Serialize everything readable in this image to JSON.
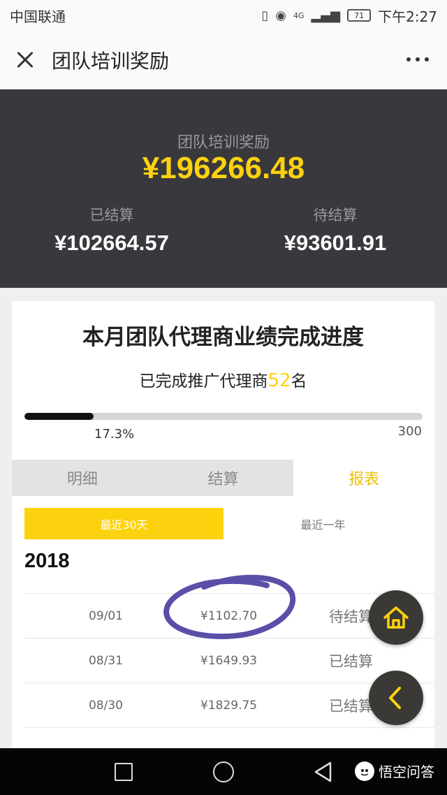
{
  "status_bar": {
    "carrier": "中国联通",
    "network": "4G",
    "battery": "71",
    "time": "下午2:27"
  },
  "appbar": {
    "title": "团队培训奖励"
  },
  "summary": {
    "label": "团队培训奖励",
    "total": "¥196266.48",
    "settled_label": "已结算",
    "settled_value": "¥102664.57",
    "pending_label": "待结算",
    "pending_value": "¥93601.91"
  },
  "card": {
    "title": "本月团队代理商业绩完成进度",
    "subtitle_prefix": "已完成推广代理商",
    "subtitle_count": "52",
    "subtitle_suffix": "名",
    "progress_fraction": 0.173,
    "progress_percent": "17.3%",
    "progress_max": "300"
  },
  "tabs": {
    "detail": "明细",
    "settle": "结算",
    "report": "报表"
  },
  "segments": {
    "recent30": "最近30天",
    "recentYear": "最近一年"
  },
  "year": "2018",
  "rows": [
    {
      "date": "09/01",
      "amount": "¥1102.70",
      "status": "待结算"
    },
    {
      "date": "08/31",
      "amount": "¥1649.93",
      "status": "已结算"
    },
    {
      "date": "08/30",
      "amount": "¥1829.75",
      "status": "已结算"
    }
  ],
  "watermark": {
    "text": "悟空问答"
  },
  "colors": {
    "accent": "#fcd20e",
    "dark_panel": "#38383d",
    "annotation": "#5a4fa8"
  }
}
